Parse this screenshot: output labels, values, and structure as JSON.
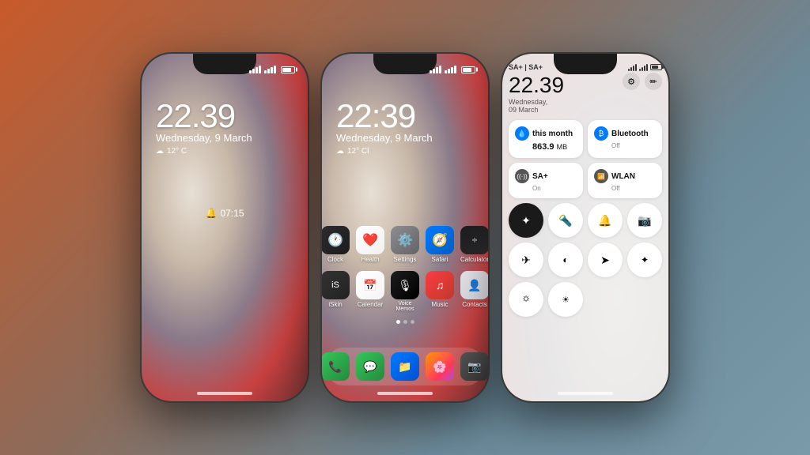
{
  "background": {
    "gradient": "orange-to-blue"
  },
  "phone1": {
    "type": "lock_screen",
    "time": "22.39",
    "date": "Wednesday, 9 March",
    "weather": "12° C",
    "alarm": "07:15",
    "status": {
      "signal1": "full",
      "wifi": "on",
      "battery": "70%"
    }
  },
  "phone2": {
    "type": "home_screen",
    "time": "22:39",
    "date": "Wednesday, 9 March",
    "weather_icon": "☁",
    "weather_temp": "12° Cl",
    "apps_row1": [
      {
        "name": "Clock",
        "emoji": "🕐",
        "bg": "clock"
      },
      {
        "name": "Health",
        "emoji": "❤️",
        "bg": "health"
      },
      {
        "name": "Settings",
        "emoji": "⚙️",
        "bg": "settings"
      },
      {
        "name": "Safari",
        "emoji": "🧭",
        "bg": "safari"
      },
      {
        "name": "Calculator",
        "emoji": "➗",
        "bg": "calc"
      }
    ],
    "apps_row2": [
      {
        "name": "iSkin",
        "emoji": "🎭",
        "bg": "iskin"
      },
      {
        "name": "Calendar",
        "emoji": "📅",
        "bg": "calendar"
      },
      {
        "name": "Voice\nMemos",
        "emoji": "🎙",
        "bg": "voicememo"
      },
      {
        "name": "Music",
        "emoji": "♫",
        "bg": "music"
      },
      {
        "name": "Contacts",
        "emoji": "👤",
        "bg": "contacts"
      }
    ],
    "dock": [
      {
        "name": "Phone",
        "emoji": "📞",
        "bg": "phone"
      },
      {
        "name": "Messages",
        "emoji": "💬",
        "bg": "messages"
      },
      {
        "name": "Files",
        "emoji": "📁",
        "bg": "files"
      },
      {
        "name": "Photos",
        "emoji": "🖼",
        "bg": "photos"
      },
      {
        "name": "Camera",
        "emoji": "📷",
        "bg": "camera"
      }
    ]
  },
  "phone3": {
    "type": "control_center",
    "carrier": "SA+ | SA+",
    "time": "22.39",
    "date": "Wednesday, 09 March",
    "tiles": [
      {
        "icon": "💧",
        "icon_bg": "#007aff",
        "label": "this month",
        "value": "863.9 MB",
        "sub": ""
      },
      {
        "icon": "🔵",
        "icon_bg": "#007aff",
        "label": "Bluetooth",
        "value": "",
        "sub": "Off"
      },
      {
        "icon": "📶",
        "icon_bg": "#555",
        "label": "SA+",
        "value": "",
        "sub": "On"
      },
      {
        "icon": "📡",
        "icon_bg": "#555",
        "label": "WLAN",
        "value": "",
        "sub": "Off"
      }
    ],
    "buttons_row1": [
      "✦",
      "🔦",
      "🔔",
      "📷"
    ],
    "buttons_row1_dark": [
      true,
      false,
      false,
      false
    ],
    "buttons_row2": [
      "✈",
      "☀",
      "➤",
      "✦"
    ],
    "buttons_row3": [
      "☀",
      "☀",
      "",
      ""
    ]
  }
}
